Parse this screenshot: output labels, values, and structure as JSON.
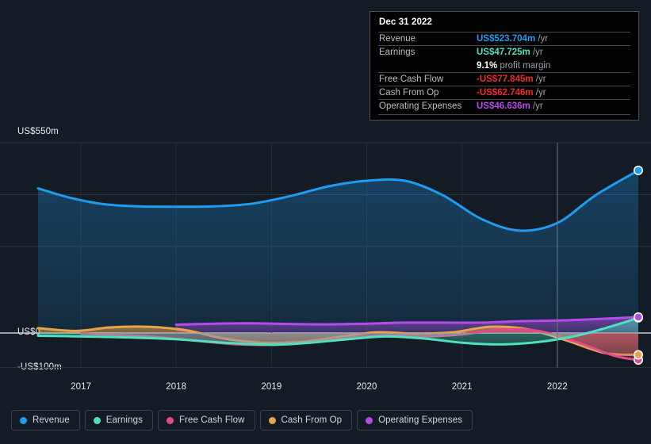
{
  "tooltip": {
    "date": "Dec 31 2022",
    "rows": [
      {
        "label": "Revenue",
        "value": "US$523.704m",
        "unit": "/yr",
        "color": "#1f9cf0"
      },
      {
        "label": "Earnings",
        "value": "US$47.725m",
        "unit": "/yr",
        "color": "#4fe0c0"
      },
      {
        "label": "",
        "value": "9.1%",
        "unit": "profit margin",
        "color": "#ffffff"
      },
      {
        "label": "Free Cash Flow",
        "value": "-US$77.845m",
        "unit": "/yr",
        "color": "#ef2a2a"
      },
      {
        "label": "Cash From Op",
        "value": "-US$62.746m",
        "unit": "/yr",
        "color": "#ef2a2a"
      },
      {
        "label": "Operating Expenses",
        "value": "US$46.636m",
        "unit": "/yr",
        "color": "#b44ce8"
      }
    ]
  },
  "axes": {
    "y_top": "US$550m",
    "y_zero": "US$0",
    "y_bottom": "-US$100m",
    "x_ticks": [
      "2017",
      "2018",
      "2019",
      "2020",
      "2021",
      "2022"
    ]
  },
  "legend": {
    "items": [
      {
        "label": "Revenue",
        "color": "#1f9cf0"
      },
      {
        "label": "Earnings",
        "color": "#4fe0c0"
      },
      {
        "label": "Free Cash Flow",
        "color": "#e04c8a"
      },
      {
        "label": "Cash From Op",
        "color": "#e8a44c"
      },
      {
        "label": "Operating Expenses",
        "color": "#b44ce8"
      }
    ]
  },
  "chart_data": {
    "type": "area",
    "title": "",
    "xlabel": "",
    "ylabel": "US$",
    "ylim": [
      -100,
      550
    ],
    "y_gridlines": [
      550,
      400,
      250,
      0,
      -100
    ],
    "grid": true,
    "legend_position": "bottom-left",
    "x_tick_values": [
      2017,
      2018,
      2019,
      2020,
      2021,
      2022
    ],
    "cursor_x": 2022.0,
    "units": "US$ millions per year",
    "series": [
      {
        "name": "Revenue",
        "color": "#1f9cf0",
        "x": [
          2016.55,
          2016.9,
          2017.25,
          2017.6,
          2018.0,
          2018.4,
          2018.8,
          2019.2,
          2019.6,
          2020.0,
          2020.4,
          2020.8,
          2021.2,
          2021.6,
          2022.0,
          2022.4,
          2022.85
        ],
        "values": [
          418,
          390,
          372,
          366,
          365,
          366,
          374,
          396,
          424,
          440,
          440,
          398,
          330,
          296,
          318,
          398,
          470
        ]
      },
      {
        "name": "Earnings",
        "color": "#4fe0c0",
        "x": [
          2016.55,
          2017.0,
          2017.5,
          2018.0,
          2018.5,
          2019.0,
          2019.4,
          2019.8,
          2020.2,
          2020.6,
          2021.0,
          2021.4,
          2021.8,
          2022.2,
          2022.6,
          2022.85
        ],
        "values": [
          -8,
          -10,
          -13,
          -18,
          -28,
          -34,
          -28,
          -18,
          -10,
          -16,
          -28,
          -33,
          -26,
          -8,
          22,
          44
        ]
      },
      {
        "name": "Free Cash Flow",
        "color": "#e04c8a",
        "x": [
          2017.0,
          2017.4,
          2017.8,
          2018.2,
          2018.6,
          2019.0,
          2019.4,
          2019.8,
          2020.2,
          2020.6,
          2021.0,
          2021.4,
          2021.8,
          2022.2,
          2022.6,
          2022.85
        ],
        "values": [
          -2,
          -6,
          -12,
          -22,
          -32,
          -34,
          -28,
          -14,
          -6,
          -10,
          -4,
          10,
          6,
          -26,
          -66,
          -78
        ]
      },
      {
        "name": "Cash From Op",
        "color": "#e8a44c",
        "x": [
          2016.55,
          2016.95,
          2017.3,
          2017.7,
          2018.1,
          2018.5,
          2018.9,
          2019.3,
          2019.7,
          2020.1,
          2020.5,
          2020.9,
          2021.3,
          2021.7,
          2022.1,
          2022.5,
          2022.85
        ],
        "values": [
          14,
          6,
          16,
          18,
          8,
          -16,
          -28,
          -26,
          -12,
          2,
          -2,
          2,
          18,
          10,
          -22,
          -58,
          -63
        ]
      },
      {
        "name": "Operating Expenses",
        "color": "#b44ce8",
        "x": [
          2018.0,
          2018.4,
          2018.8,
          2019.2,
          2019.6,
          2020.0,
          2020.4,
          2020.8,
          2021.2,
          2021.6,
          2022.0,
          2022.4,
          2022.85
        ],
        "values": [
          24,
          27,
          28,
          26,
          25,
          27,
          30,
          30,
          30,
          34,
          36,
          40,
          46
        ]
      }
    ]
  }
}
